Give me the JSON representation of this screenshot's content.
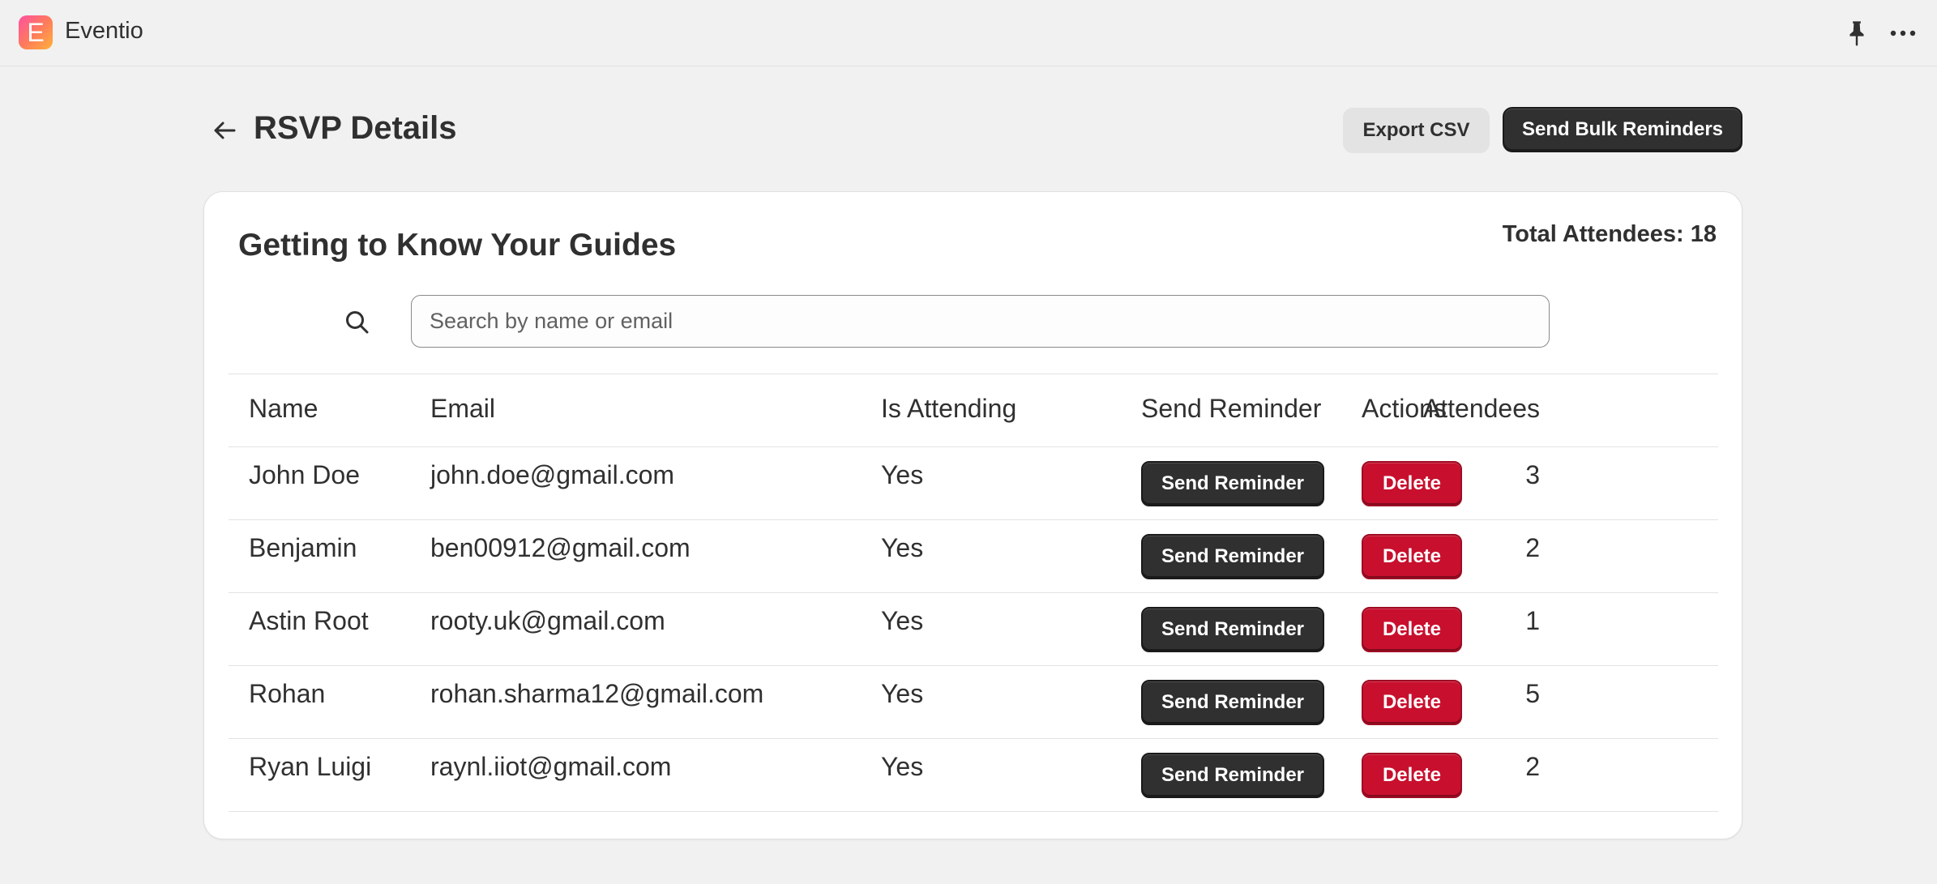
{
  "app": {
    "name": "Eventio",
    "logo_letter": "E",
    "icons": [
      "pin-icon",
      "more-icon"
    ]
  },
  "header": {
    "title": "RSVP Details",
    "back_icon": "arrow-left-icon",
    "export_label": "Export CSV",
    "bulk_label": "Send Bulk Reminders"
  },
  "card": {
    "title": "Getting to Know Your Guides",
    "total_attendees": "Total Attendees: 18",
    "search": {
      "placeholder": "Search by name or email",
      "value": ""
    }
  },
  "table": {
    "columns": [
      "Name",
      "Email",
      "Is Attending",
      "Send Reminder",
      "Attendees",
      "Actions"
    ],
    "rows": [
      {
        "name": "John Doe",
        "email": "john.doe@gmail.com",
        "attending": "Yes",
        "reminder_label": "Send Reminder",
        "attendees": "3",
        "action_label": "Delete"
      },
      {
        "name": "Benjamin",
        "email": "ben00912@gmail.com",
        "attending": "Yes",
        "reminder_label": "Send Reminder",
        "attendees": "2",
        "action_label": "Delete"
      },
      {
        "name": "Astin Root",
        "email": "rooty.uk@gmail.com",
        "attending": "Yes",
        "reminder_label": "Send Reminder",
        "attendees": "1",
        "action_label": "Delete"
      },
      {
        "name": "Rohan",
        "email": "rohan.sharma12@gmail.com",
        "attending": "Yes",
        "reminder_label": "Send Reminder",
        "attendees": "5",
        "action_label": "Delete"
      },
      {
        "name": "Ryan Luigi",
        "email": "raynl.iiot@gmail.com",
        "attending": "Yes",
        "reminder_label": "Send Reminder",
        "attendees": "2",
        "action_label": "Delete"
      }
    ]
  },
  "colors": {
    "background": "#f1f1f1",
    "primary_button": "#303030",
    "danger_button": "#c8102e",
    "secondary_button": "#e3e3e3"
  }
}
